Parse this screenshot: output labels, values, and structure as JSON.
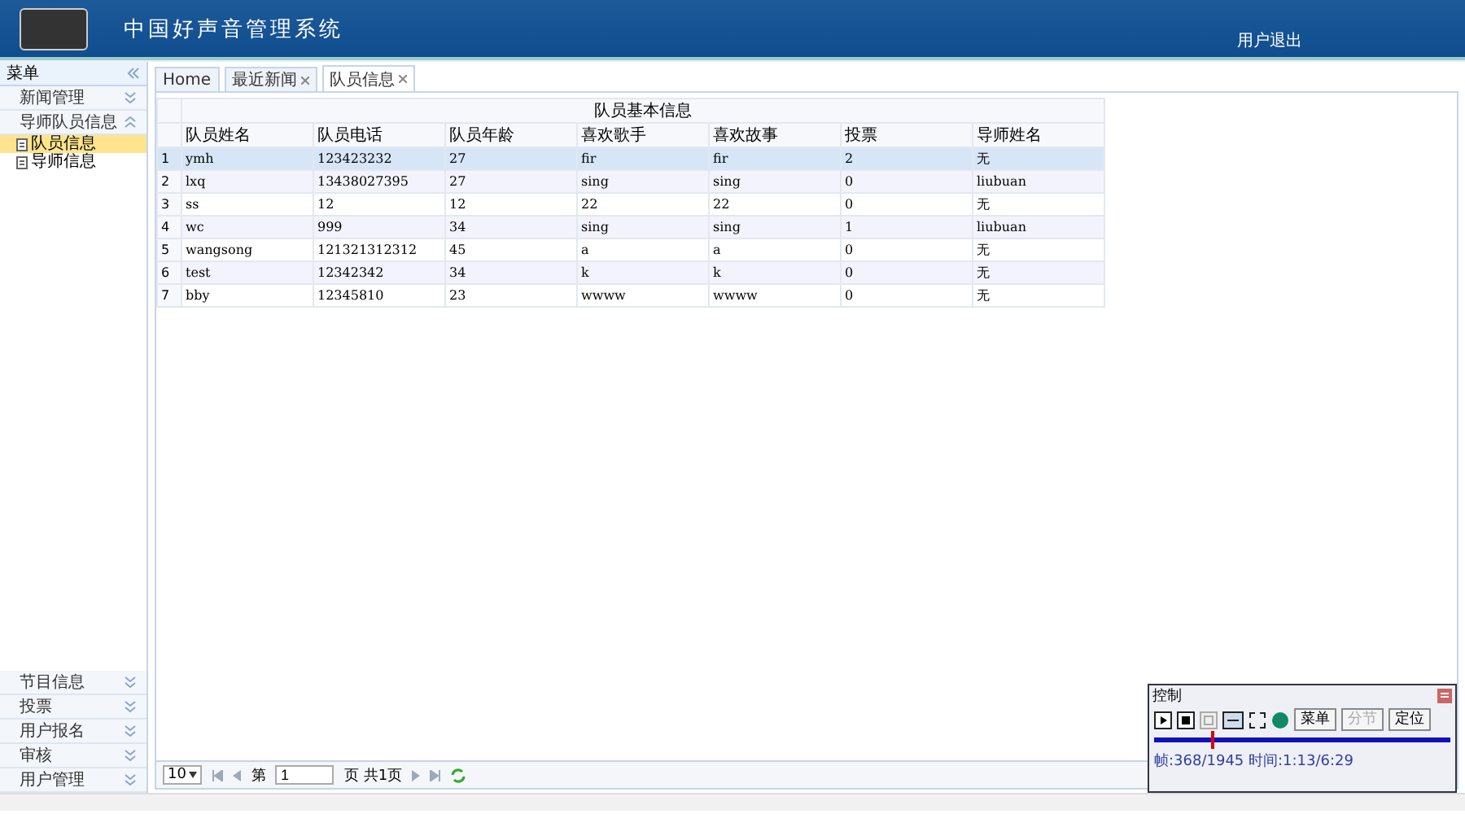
{
  "header": {
    "title": "中国好声音管理系统",
    "logout": "用户退出"
  },
  "sidebar": {
    "title": "菜单",
    "groups": [
      {
        "label": "新闻管理",
        "expanded": false
      },
      {
        "label": "导师队员信息",
        "expanded": true,
        "items": [
          {
            "label": "队员信息",
            "selected": true
          },
          {
            "label": "导师信息",
            "selected": false
          }
        ]
      }
    ],
    "bottom_groups": [
      {
        "label": "节目信息",
        "expanded": false
      },
      {
        "label": "投票",
        "expanded": false
      },
      {
        "label": "用户报名",
        "expanded": false
      },
      {
        "label": "审核",
        "expanded": false
      },
      {
        "label": "用户管理",
        "expanded": false
      }
    ]
  },
  "tabs": [
    {
      "label": "Home",
      "closable": false,
      "selected": false
    },
    {
      "label": "最近新闻",
      "closable": true,
      "selected": false
    },
    {
      "label": "队员信息",
      "closable": true,
      "selected": true
    }
  ],
  "table": {
    "group_header": "队员基本信息",
    "columns": [
      "队员姓名",
      "队员电话",
      "队员年龄",
      "喜欢歌手",
      "喜欢故事",
      "投票",
      "导师姓名"
    ],
    "rows": [
      {
        "number": "1",
        "selected": true,
        "cells": [
          "ymh",
          "123423232",
          "27",
          "fir",
          "fir",
          "2",
          "无"
        ]
      },
      {
        "number": "2",
        "selected": false,
        "cells": [
          "lxq",
          "13438027395",
          "27",
          "sing",
          "sing",
          "0",
          "liubuan"
        ]
      },
      {
        "number": "3",
        "selected": false,
        "cells": [
          "ss",
          "12",
          "12",
          "22",
          "22",
          "0",
          "无"
        ]
      },
      {
        "number": "4",
        "selected": false,
        "cells": [
          "wc",
          "999",
          "34",
          "sing",
          "sing",
          "1",
          "liubuan"
        ]
      },
      {
        "number": "5",
        "selected": false,
        "cells": [
          "wangsong",
          "121321312312",
          "45",
          "a",
          "a",
          "0",
          "无"
        ]
      },
      {
        "number": "6",
        "selected": false,
        "cells": [
          "test",
          "12342342",
          "34",
          "k",
          "k",
          "0",
          "无"
        ]
      },
      {
        "number": "7",
        "selected": false,
        "cells": [
          "bby",
          "12345810",
          "23",
          "wwww",
          "wwww",
          "0",
          "无"
        ]
      }
    ]
  },
  "pager": {
    "page_size": "10",
    "page_prefix": "第",
    "page": "1",
    "page_suffix": "页 共1页"
  },
  "control_window": {
    "title": "控制",
    "buttons": [
      {
        "label": "菜单",
        "disabled": false
      },
      {
        "label": "分节",
        "disabled": true
      },
      {
        "label": "定位",
        "disabled": false
      }
    ],
    "level": 0.19,
    "status": "帧:368/1945 时间:1:13/6:29"
  }
}
